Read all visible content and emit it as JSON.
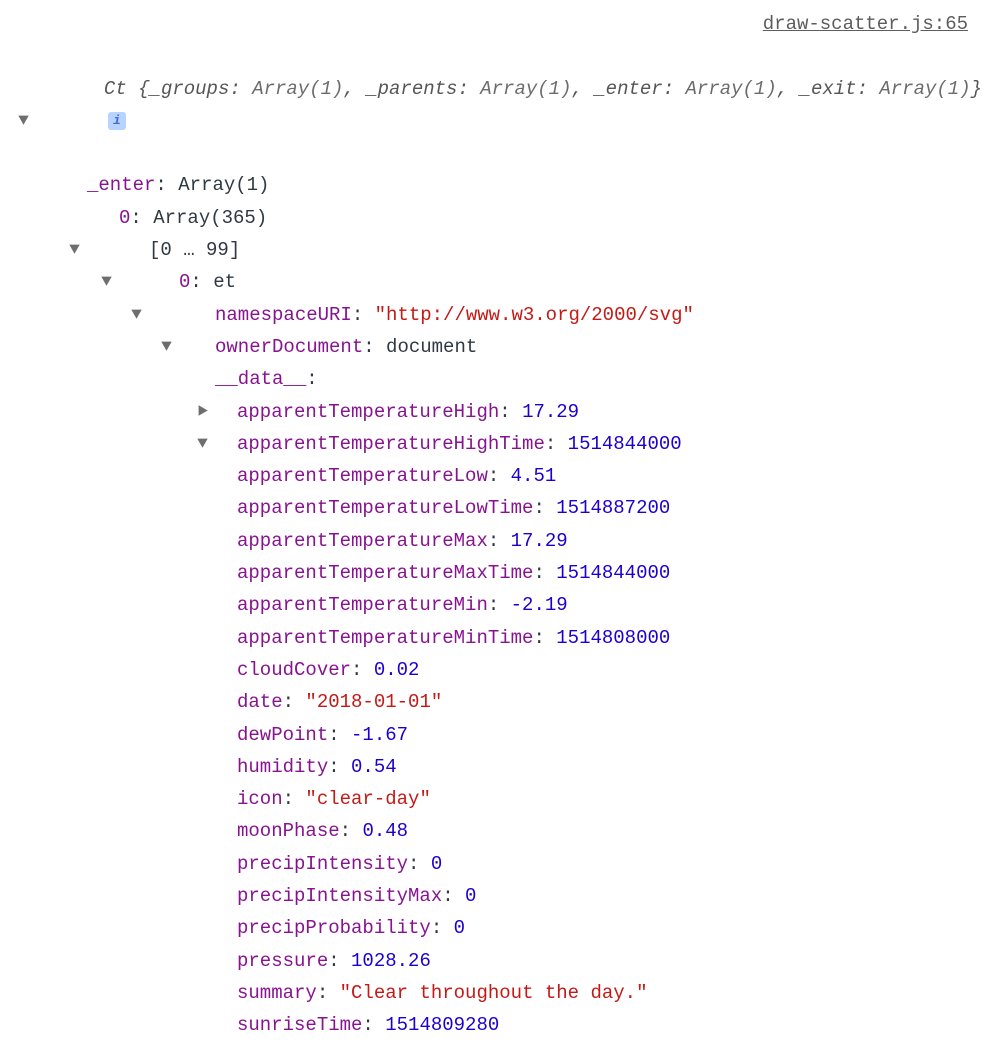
{
  "source_link": "draw-scatter.js:65",
  "summary": {
    "class_name": "Ct",
    "open": "{",
    "close": "}",
    "pairs": [
      {
        "k": "_groups",
        "v": "Array(1)"
      },
      {
        "k": "_parents",
        "v": "Array(1)"
      },
      {
        "k": "_enter",
        "v": "Array(1)"
      },
      {
        "k": "_exit",
        "v": "Array(1)"
      }
    ],
    "info": "i"
  },
  "tree": {
    "enter_key": "_enter",
    "enter_val": "Array(1)",
    "zero_key": "0",
    "zero_val": "Array(365)",
    "range_label": "[0 … 99]",
    "item_key": "0",
    "item_val": "et",
    "ns_key": "namespaceURI",
    "ns_val": "\"http://www.w3.org/2000/svg\"",
    "owner_key": "ownerDocument",
    "owner_val": "document",
    "data_key": "__data__",
    "props": [
      {
        "k": "apparentTemperatureHigh",
        "v": "17.29",
        "t": "num"
      },
      {
        "k": "apparentTemperatureHighTime",
        "v": "1514844000",
        "t": "num"
      },
      {
        "k": "apparentTemperatureLow",
        "v": "4.51",
        "t": "num"
      },
      {
        "k": "apparentTemperatureLowTime",
        "v": "1514887200",
        "t": "num"
      },
      {
        "k": "apparentTemperatureMax",
        "v": "17.29",
        "t": "num"
      },
      {
        "k": "apparentTemperatureMaxTime",
        "v": "1514844000",
        "t": "num"
      },
      {
        "k": "apparentTemperatureMin",
        "v": "-2.19",
        "t": "num"
      },
      {
        "k": "apparentTemperatureMinTime",
        "v": "1514808000",
        "t": "num"
      },
      {
        "k": "cloudCover",
        "v": "0.02",
        "t": "num"
      },
      {
        "k": "date",
        "v": "\"2018-01-01\"",
        "t": "str"
      },
      {
        "k": "dewPoint",
        "v": "-1.67",
        "t": "num"
      },
      {
        "k": "humidity",
        "v": "0.54",
        "t": "num"
      },
      {
        "k": "icon",
        "v": "\"clear-day\"",
        "t": "str"
      },
      {
        "k": "moonPhase",
        "v": "0.48",
        "t": "num"
      },
      {
        "k": "precipIntensity",
        "v": "0",
        "t": "num"
      },
      {
        "k": "precipIntensityMax",
        "v": "0",
        "t": "num"
      },
      {
        "k": "precipProbability",
        "v": "0",
        "t": "num"
      },
      {
        "k": "pressure",
        "v": "1028.26",
        "t": "num"
      },
      {
        "k": "summary",
        "v": "\"Clear throughout the day.\"",
        "t": "str"
      },
      {
        "k": "sunriseTime",
        "v": "1514809280",
        "t": "num"
      }
    ]
  }
}
